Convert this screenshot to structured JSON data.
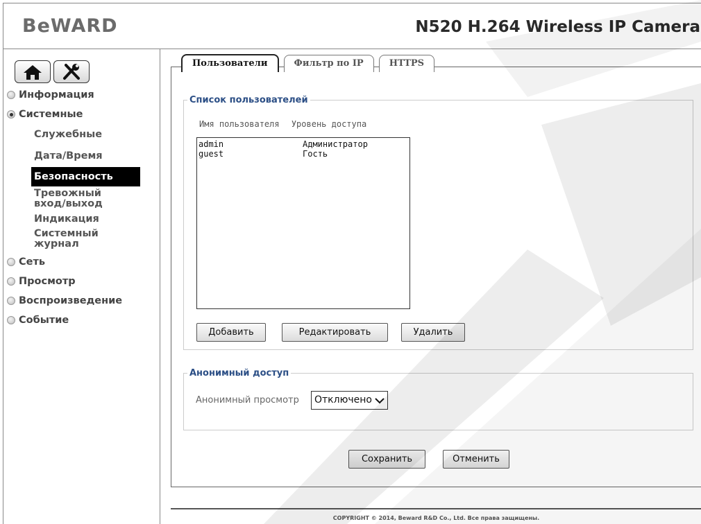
{
  "header": {
    "logo": "BeWARD",
    "camera_title": "N520 H.264 Wireless IP Camera"
  },
  "sidebar": {
    "home_icon": "home-icon",
    "settings_icon": "tools-icon",
    "menu": [
      {
        "label": "Информация",
        "expanded": false
      },
      {
        "label": "Системные",
        "expanded": true
      },
      {
        "label": "Сеть",
        "expanded": false
      },
      {
        "label": "Просмотр",
        "expanded": false
      },
      {
        "label": "Воспроизведение",
        "expanded": false
      },
      {
        "label": "Событие",
        "expanded": false
      }
    ],
    "submenu": [
      {
        "label": "Служебные"
      },
      {
        "label": "Дата/Время"
      },
      {
        "label": "Безопасность",
        "active": true
      },
      {
        "label": "Тревожный вход/выход"
      },
      {
        "label": "Индикация"
      },
      {
        "label": "Системный журнал"
      }
    ]
  },
  "tabs": [
    {
      "label": "Пользователи",
      "active": true
    },
    {
      "label": "Фильтр по IP"
    },
    {
      "label": "HTTPS"
    }
  ],
  "users": {
    "legend": "Список пользователей",
    "col_name": "Имя пользователя",
    "col_level": "Уровень доступа",
    "rows": [
      {
        "name": "admin",
        "level": "Администратор"
      },
      {
        "name": "guest",
        "level": "Гость"
      }
    ],
    "add_label": "Добавить",
    "edit_label": "Редактировать",
    "delete_label": "Удалить"
  },
  "anonymous": {
    "legend": "Анонимный доступ",
    "view_label": "Анонимный просмотр",
    "view_value": "Отключено"
  },
  "actions": {
    "save_label": "Сохранить",
    "cancel_label": "Отменить"
  },
  "footer": {
    "copyright": "COPYRIGHT © 2014, Beward R&D Co., Ltd. Все права защищены."
  },
  "colors": {
    "legend": "#2c4f86",
    "active_nav_bg": "#000000"
  }
}
